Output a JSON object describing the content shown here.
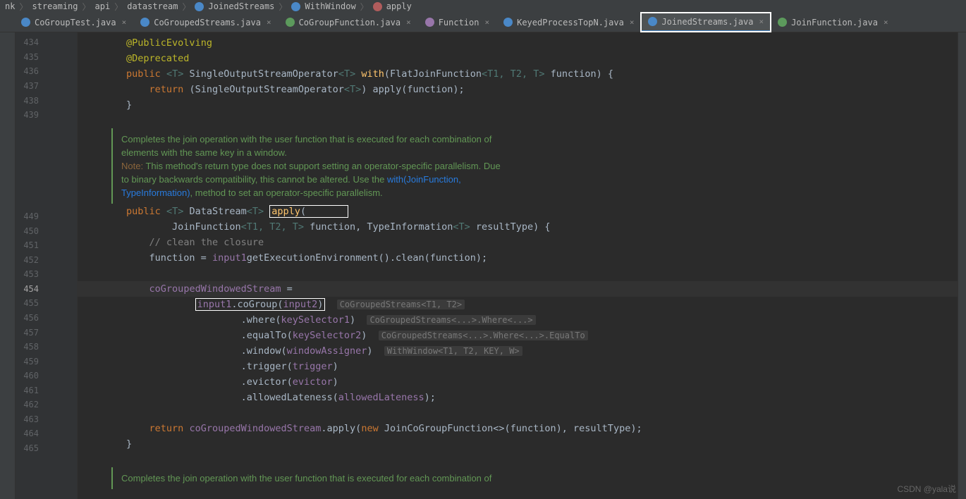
{
  "breadcrumb": [
    "nk",
    "streaming",
    "api",
    "datastream",
    "JoinedStreams",
    "WithWindow",
    "apply"
  ],
  "tabs": [
    {
      "label": "CoGroupTest.java",
      "icon": "class",
      "active": false
    },
    {
      "label": "CoGroupedStreams.java",
      "icon": "class",
      "active": false
    },
    {
      "label": "CoGroupFunction.java",
      "icon": "interface",
      "active": false
    },
    {
      "label": "Function",
      "icon": "func",
      "active": false
    },
    {
      "label": "KeyedProcessTopN.java",
      "icon": "class",
      "active": false
    },
    {
      "label": "JoinedStreams.java",
      "icon": "class",
      "active": true,
      "highlighted": true
    },
    {
      "label": "JoinFunction.java",
      "icon": "interface",
      "active": false
    }
  ],
  "lines": {
    "434": {
      "anno": "@PublicEvolving"
    },
    "435": {
      "anno": "@Deprecated"
    },
    "436": {
      "kw": "public",
      "gen": "<T>",
      "ret": "SingleOutputStreamOperator",
      "rgen": "<T>",
      "method": "with",
      "paren": "(",
      "ptype": "FlatJoinFunction",
      "pgen": "<T1, T2, T>",
      "pname": " function) {"
    },
    "437": {
      "t": "            ",
      "kw": "return",
      "t2": " (SingleOutputStreamOperator",
      "gen": "<T>",
      "t3": ") apply(function);"
    },
    "438": {
      "t": "        }"
    },
    "439": {
      "t": ""
    },
    "449": {
      "kw": "public",
      "gen": "<T>",
      "ret": "DataStream",
      "rgen": "<T>",
      "method": "apply"
    },
    "450": {
      "t": "                ",
      "ptype": "JoinFunction",
      "pgen": "<T1, T2, T>",
      "pname": " function, ",
      "ptype2": "TypeInformation",
      "pgen2": "<T>",
      "pname2": " resultType) {"
    },
    "451": {
      "t": "            ",
      "comment": "// clean the closure"
    },
    "452": {
      "t": "            function = ",
      "field": "input1",
      ".": ".",
      "call": "getExecutionEnvironment().clean(function);"
    },
    "453": {
      "t": ""
    },
    "454": {
      "t": "            ",
      "field": "coGroupedWindowedStream",
      "t2": " ="
    },
    "455": {
      "t": "                    ",
      "box": "input1.coGroup(input2)",
      "hint": "CoGroupedStreams<T1, T2>"
    },
    "456": {
      "t": "                            .where(",
      "field": "keySelector1",
      "t2": ")",
      "hint": "CoGroupedStreams<...>.Where<...>"
    },
    "457": {
      "t": "                            .equalTo(",
      "field": "keySelector2",
      "t2": ")",
      "hint": "CoGroupedStreams<...>.Where<...>.EqualTo"
    },
    "458": {
      "t": "                            .window(",
      "field": "windowAssigner",
      "t2": ")",
      "hint": "WithWindow<T1, T2, KEY, W>"
    },
    "459": {
      "t": "                            .trigger(",
      "field": "trigger",
      "t2": ")"
    },
    "460": {
      "t": "                            .evictor(",
      "field": "evictor",
      "t2": ")"
    },
    "461": {
      "t": "                            .allowedLateness(",
      "field": "allowedLateness",
      "t2": ");"
    },
    "462": {
      "t": ""
    },
    "463": {
      "t": "            ",
      "kw": "return",
      "t2": " ",
      "field": "coGroupedWindowedStream",
      "t3": ".apply(",
      "kw2": "new",
      "t4": " JoinCoGroupFunction<>(function), resultType);"
    },
    "464": {
      "t": "        }"
    },
    "465": {
      "t": ""
    }
  },
  "doc1": {
    "l1": "Completes the join operation with the user function that is executed for each combination of",
    "l2": "elements with the same key in a window.",
    "l3a": "Note: ",
    "l3b": "This method's return type does not support setting an operator-specific parallelism. Due",
    "l4a": "to binary backwards compatibility, this cannot be altered. Use the ",
    "l4b": "with(JoinFunction,",
    "l5a": "TypeInformation)",
    "l5b": ", method to set an operator-specific parallelism."
  },
  "doc2": {
    "l1": "Completes the join operation with the user function that is executed for each combination of"
  },
  "lineNumbers": [
    "434",
    "435",
    "436",
    "437",
    "438",
    "439",
    "",
    "",
    "",
    "",
    "",
    "",
    "449",
    "450",
    "451",
    "452",
    "453",
    "454",
    "455",
    "456",
    "457",
    "458",
    "459",
    "460",
    "461",
    "462",
    "463",
    "464",
    "465",
    "",
    "",
    ""
  ],
  "watermark": "CSDN @yala说"
}
